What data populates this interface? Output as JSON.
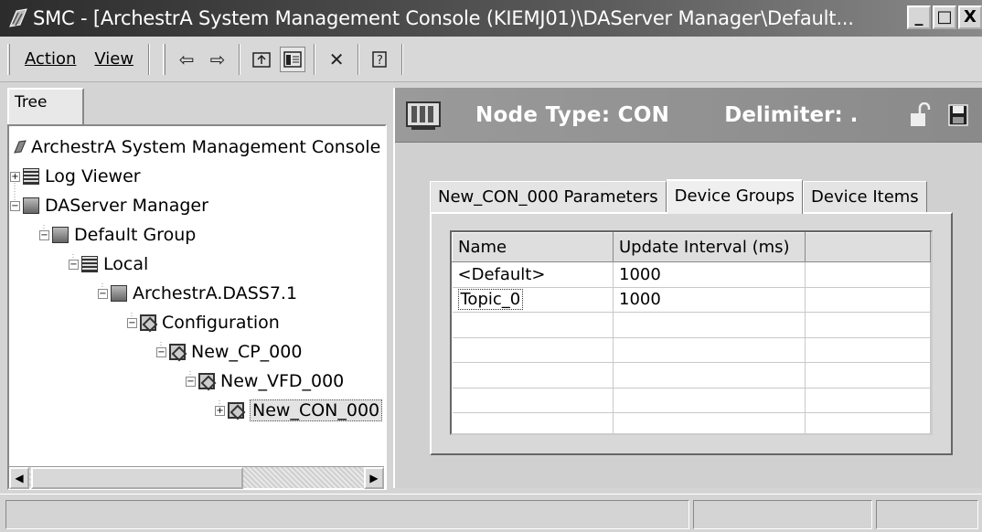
{
  "window": {
    "title": "SMC - [ArchestrA System Management Console (KIEMJ01)\\DAServer Manager\\Default...",
    "buttons": [
      "_",
      "□",
      "X"
    ]
  },
  "menu": {
    "items": [
      {
        "label": "Action"
      },
      {
        "label": "View"
      }
    ]
  },
  "toolbar": {
    "icons": [
      "back-arrow-icon",
      "forward-arrow-icon",
      "up-folder-icon",
      "show-hide-tree-icon",
      "delete-icon",
      "help-icon"
    ]
  },
  "tree": {
    "tab_label": "Tree",
    "nodes": [
      {
        "label": "ArchestrA System Management Console",
        "icon": "smc-root-icon"
      },
      {
        "label": "Log Viewer",
        "icon": "log-viewer-icon",
        "expander": "+"
      },
      {
        "label": "DAServer Manager",
        "icon": "daserver-manager-icon",
        "expander": "−"
      },
      {
        "label": "Default Group",
        "icon": "group-icon",
        "expander": "−"
      },
      {
        "label": "Local",
        "icon": "computer-icon",
        "expander": "−"
      },
      {
        "label": "ArchestrA.DASS7.1",
        "icon": "server-icon",
        "expander": "−"
      },
      {
        "label": "Configuration",
        "icon": "config-icon",
        "expander": "−"
      },
      {
        "label": "New_CP_000",
        "icon": "device-icon",
        "expander": "−"
      },
      {
        "label": "New_VFD_000",
        "icon": "device-icon",
        "expander": "−"
      },
      {
        "label": "New_CON_000",
        "icon": "device-icon",
        "expander": "+",
        "selected": true
      }
    ]
  },
  "detail": {
    "node_type": "Node Type: CON",
    "delimiter": "Delimiter: .",
    "tabs": [
      {
        "label": "New_CON_000 Parameters"
      },
      {
        "label": "Device Groups",
        "active": true
      },
      {
        "label": "Device Items"
      }
    ],
    "grid": {
      "columns": [
        "Name",
        "Update Interval (ms)",
        ""
      ],
      "rows": [
        {
          "name": "<Default>",
          "interval": "1000"
        },
        {
          "name": "Topic_0",
          "interval": "1000"
        },
        {
          "name": "",
          "interval": ""
        },
        {
          "name": "",
          "interval": ""
        },
        {
          "name": "",
          "interval": ""
        },
        {
          "name": "",
          "interval": ""
        },
        {
          "name": "",
          "interval": ""
        }
      ]
    }
  },
  "colors": {
    "titlebar_dark": "#2c2c2c",
    "panel": "#d4d4d4",
    "header_gray": "#9a9a9a"
  }
}
